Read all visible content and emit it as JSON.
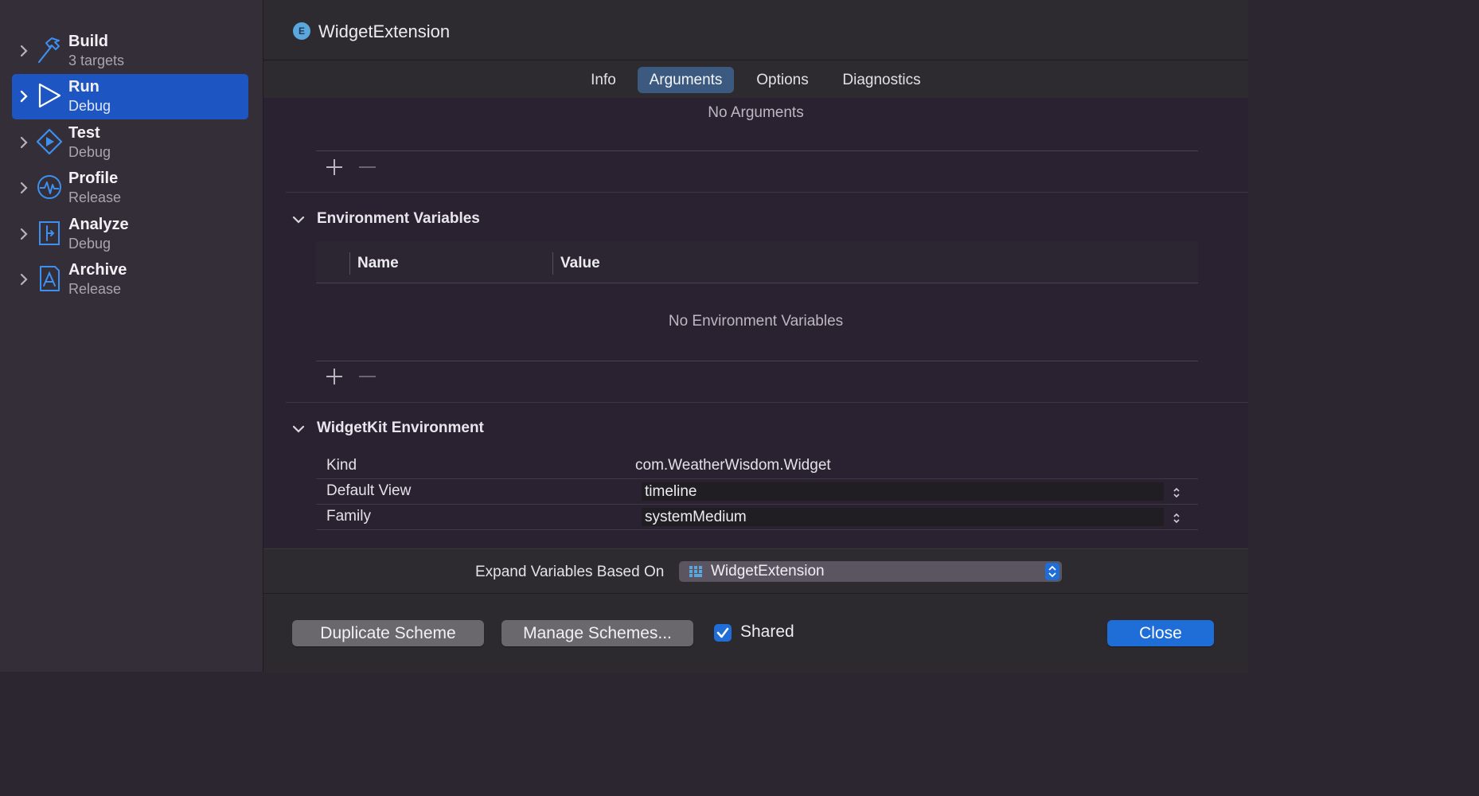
{
  "sidebar": {
    "items": [
      {
        "title": "Build",
        "subtitle": "3 targets",
        "icon": "hammer-icon"
      },
      {
        "title": "Run",
        "subtitle": "Debug",
        "icon": "play-icon"
      },
      {
        "title": "Test",
        "subtitle": "Debug",
        "icon": "test-diamond-icon"
      },
      {
        "title": "Profile",
        "subtitle": "Release",
        "icon": "waveform-icon"
      },
      {
        "title": "Analyze",
        "subtitle": "Debug",
        "icon": "analyze-icon"
      },
      {
        "title": "Archive",
        "subtitle": "Release",
        "icon": "archive-icon"
      }
    ],
    "selected_index": 1
  },
  "header": {
    "badge": "E",
    "title": "WidgetExtension"
  },
  "tabs": [
    {
      "label": "Info"
    },
    {
      "label": "Arguments"
    },
    {
      "label": "Options"
    },
    {
      "label": "Diagnostics"
    }
  ],
  "active_tab": "Arguments",
  "arguments": {
    "empty_text": "No Arguments"
  },
  "env": {
    "heading": "Environment Variables",
    "col_name": "Name",
    "col_value": "Value",
    "empty_text": "No Environment Variables"
  },
  "widgetkit": {
    "heading": "WidgetKit Environment",
    "kind_label": "Kind",
    "kind_value": "com.WeatherWisdom.Widget",
    "default_view_label": "Default View",
    "default_view_value": "timeline",
    "family_label": "Family",
    "family_value": "systemMedium"
  },
  "expand": {
    "label": "Expand Variables Based On",
    "value": "WidgetExtension"
  },
  "footer": {
    "duplicate": "Duplicate Scheme",
    "manage": "Manage Schemes...",
    "shared_label": "Shared",
    "shared_checked": true,
    "close": "Close"
  },
  "colors": {
    "accent": "#1f6ed8",
    "selection": "#1d56c2",
    "icon_blue": "#3d8ff0"
  }
}
